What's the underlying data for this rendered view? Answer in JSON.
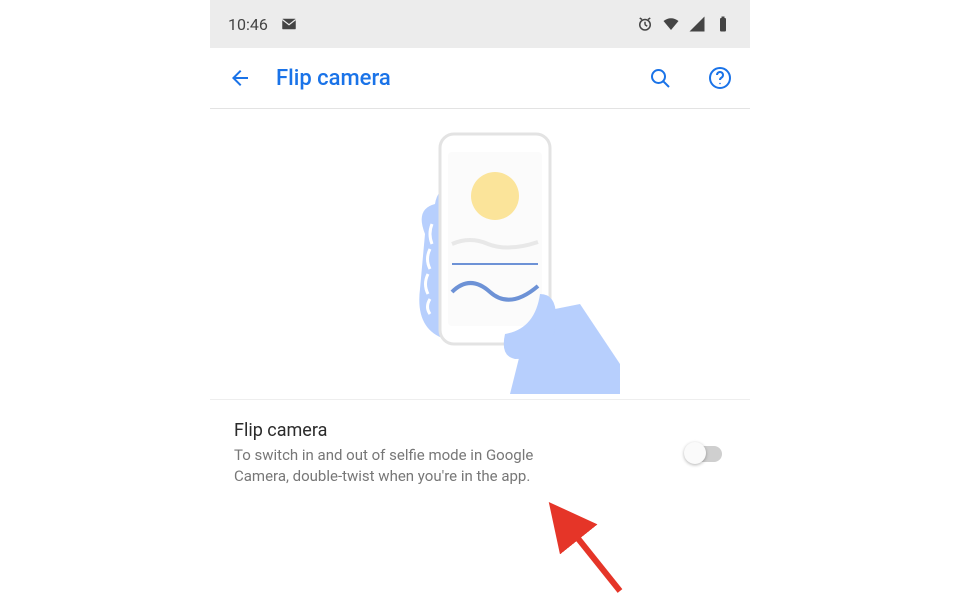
{
  "status_bar": {
    "time": "10:46"
  },
  "header": {
    "title": "Flip camera"
  },
  "setting": {
    "title": "Flip camera",
    "description": "To switch in and out of selfie mode in Google Camera, double-twist when you're in the app.",
    "toggled": false
  }
}
